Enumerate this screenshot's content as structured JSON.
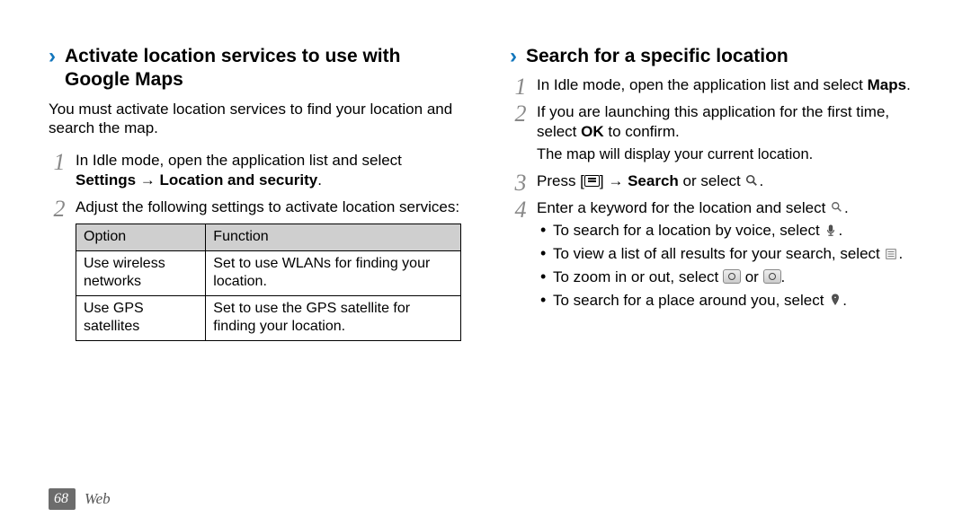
{
  "left": {
    "title": "Activate location services to use with Google Maps",
    "intro": "You must activate location services to find your location and search the map.",
    "steps": [
      {
        "pre": "In Idle mode, open the application list and select ",
        "bold": "Settings → Location and security",
        "post": "."
      },
      {
        "pre": "Adjust the following settings to activate location services:",
        "bold": "",
        "post": ""
      }
    ],
    "table": {
      "head": [
        "Option",
        "Function"
      ],
      "rows": [
        [
          "Use wireless networks",
          "Set to use WLANs for finding your location."
        ],
        [
          "Use GPS satellites",
          "Set to use the GPS satellite for finding your location."
        ]
      ]
    }
  },
  "right": {
    "title": "Search for a specific location",
    "step1": {
      "pre": "In Idle mode, open the application list and select ",
      "bold": "Maps",
      "post": "."
    },
    "step2a": "If you are launching this application for the first time, select ",
    "step2bold": "OK",
    "step2b": " to confirm.",
    "step2tail": "The map will display your current location.",
    "step3a": "Press [",
    "step3b": "] → ",
    "step3bold": "Search",
    "step3c": " or select ",
    "step4a": "Enter a keyword for the location and select ",
    "bullets": [
      "To search for a location by voice, select ",
      "To view a list of all results for your search, select ",
      "To zoom in or out, select ",
      "To search for a place around you, select "
    ],
    "or": " or "
  },
  "footer": {
    "page": "68",
    "section": "Web"
  }
}
